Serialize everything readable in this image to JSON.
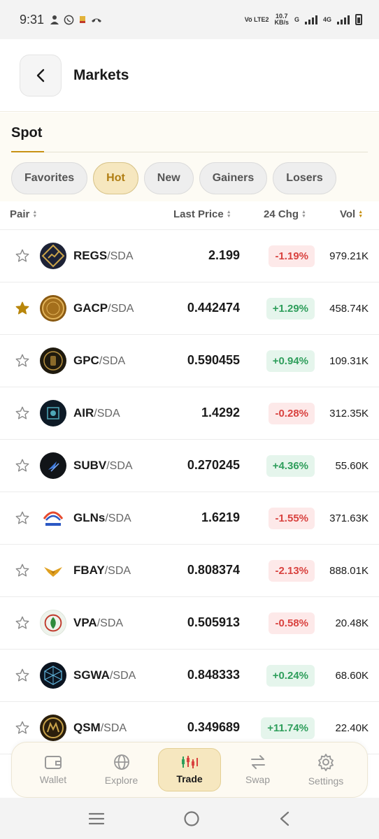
{
  "status": {
    "time": "9:31",
    "net_label": "Vo̅ LTE2",
    "speed": "10.7",
    "speed_unit": "KB/s",
    "net_g": "G",
    "net_4g": "4G"
  },
  "header": {
    "title": "Markets"
  },
  "spot": {
    "tab_label": "Spot"
  },
  "filters": [
    {
      "label": "Favorites",
      "active": false
    },
    {
      "label": "Hot",
      "active": true
    },
    {
      "label": "New",
      "active": false
    },
    {
      "label": "Gainers",
      "active": false
    },
    {
      "label": "Losers",
      "active": false
    }
  ],
  "table": {
    "headers": {
      "pair": "Pair",
      "price": "Last Price",
      "chg": "24 Chg",
      "vol": "Vol"
    },
    "rows": [
      {
        "base": "REGS",
        "quote": "/SDA",
        "price": "2.199",
        "chg": "-1.19%",
        "dir": "neg",
        "vol": "979.21K",
        "fav": false,
        "logo_bg": "#1d2236"
      },
      {
        "base": "GACP",
        "quote": "/SDA",
        "price": "0.442474",
        "chg": "+1.29%",
        "dir": "pos",
        "vol": "458.74K",
        "fav": true,
        "logo_bg": "#8a5a12"
      },
      {
        "base": "GPC",
        "quote": "/SDA",
        "price": "0.590455",
        "chg": "+0.94%",
        "dir": "pos",
        "vol": "109.31K",
        "fav": false,
        "logo_bg": "#1f1a0e"
      },
      {
        "base": "AIR",
        "quote": "/SDA",
        "price": "1.4292",
        "chg": "-0.28%",
        "dir": "neg",
        "vol": "312.35K",
        "fav": false,
        "logo_bg": "#0d1a26"
      },
      {
        "base": "SUBV",
        "quote": "/SDA",
        "price": "0.270245",
        "chg": "+4.36%",
        "dir": "pos",
        "vol": "55.60K",
        "fav": false,
        "logo_bg": "#111418"
      },
      {
        "base": "GLNs",
        "quote": "/SDA",
        "price": "1.6219",
        "chg": "-1.55%",
        "dir": "neg",
        "vol": "371.63K",
        "fav": false,
        "logo_bg": "#ffffff"
      },
      {
        "base": "FBAY",
        "quote": "/SDA",
        "price": "0.808374",
        "chg": "-2.13%",
        "dir": "neg",
        "vol": "888.01K",
        "fav": false,
        "logo_bg": "#ffffff"
      },
      {
        "base": "VPA",
        "quote": "/SDA",
        "price": "0.505913",
        "chg": "-0.58%",
        "dir": "neg",
        "vol": "20.48K",
        "fav": false,
        "logo_bg": "#eef3ec"
      },
      {
        "base": "SGWA",
        "quote": "/SDA",
        "price": "0.848333",
        "chg": "+0.24%",
        "dir": "pos",
        "vol": "68.60K",
        "fav": false,
        "logo_bg": "#0b1420"
      },
      {
        "base": "QSM",
        "quote": "/SDA",
        "price": "0.349689",
        "chg": "+11.74%",
        "dir": "pos",
        "vol": "22.40K",
        "fav": false,
        "logo_bg": "#2a1e0c"
      }
    ]
  },
  "nav": [
    {
      "label": "Wallet",
      "icon": "wallet-icon",
      "active": false
    },
    {
      "label": "Explore",
      "icon": "globe-icon",
      "active": false
    },
    {
      "label": "Trade",
      "icon": "candlestick-icon",
      "active": true
    },
    {
      "label": "Swap",
      "icon": "swap-icon",
      "active": false
    },
    {
      "label": "Settings",
      "icon": "gear-icon",
      "active": false
    }
  ],
  "colors": {
    "accent": "#c89214",
    "negative": "#d9423f",
    "positive": "#2e9e5b"
  }
}
